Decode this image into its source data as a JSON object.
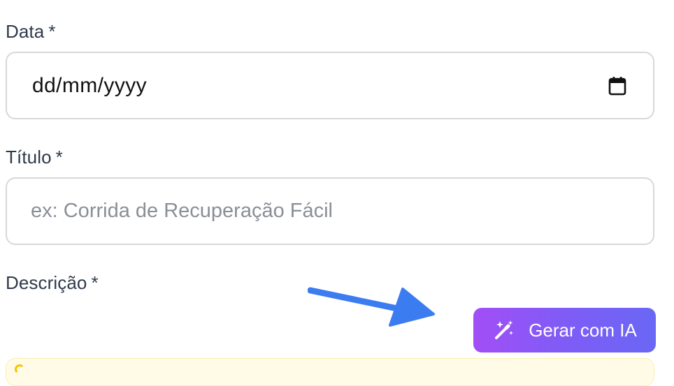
{
  "form": {
    "date": {
      "label": "Data",
      "required_mark": "*",
      "value": "dd/mm/yyyy",
      "icon": "calendar-icon"
    },
    "title": {
      "label": "Título",
      "required_mark": "*",
      "placeholder": "ex: Corrida de Recuperação Fácil",
      "value": ""
    },
    "description": {
      "label": "Descrição",
      "required_mark": "*",
      "generate_button_label": "Gerar com IA",
      "generate_button_icon": "magic-wand-icon"
    }
  },
  "colors": {
    "button_gradient_start": "#a24ef6",
    "button_gradient_end": "#6a67f5",
    "arrow": "#3b7cf0",
    "notice_background": "#fffbe6",
    "notice_accent": "#f5c400"
  }
}
